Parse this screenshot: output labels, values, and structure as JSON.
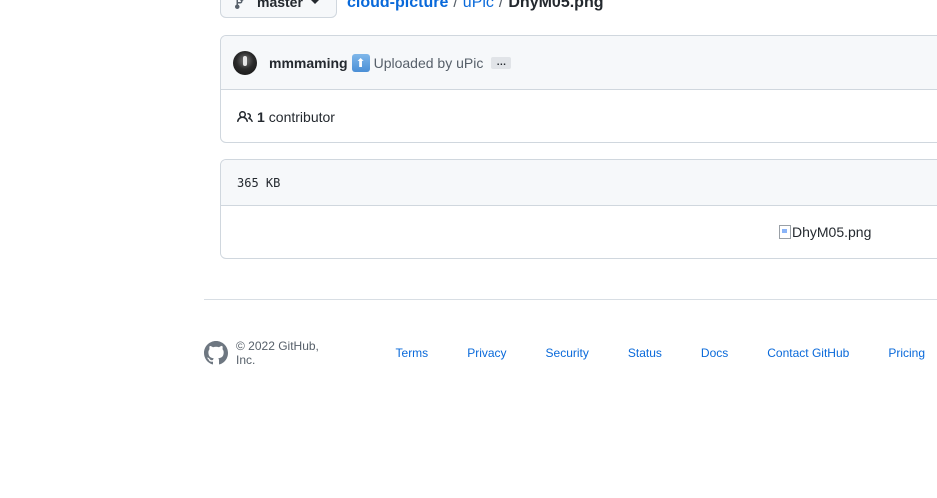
{
  "nav": {
    "branch": "master",
    "breadcrumb": {
      "repo": "cloud-picture",
      "folder": "uPic",
      "separator": "/",
      "file": "DhyM05.png"
    }
  },
  "commit": {
    "author": "mmmaming",
    "emoji": "⬆️",
    "message": "Uploaded by uPic",
    "more": "…",
    "contributors_count": "1",
    "contributors_label": "contributor"
  },
  "file": {
    "size": "365 KB",
    "image_alt": "DhyM05.png"
  },
  "footer": {
    "copyright": "© 2022 GitHub, Inc.",
    "links": [
      "Terms",
      "Privacy",
      "Security",
      "Status",
      "Docs",
      "Contact GitHub",
      "Pricing"
    ]
  },
  "colors": {
    "link": "#0969da",
    "text": "#24292f",
    "muted": "#57606a",
    "border": "#d0d7de",
    "header_bg": "#f6f8fa"
  }
}
